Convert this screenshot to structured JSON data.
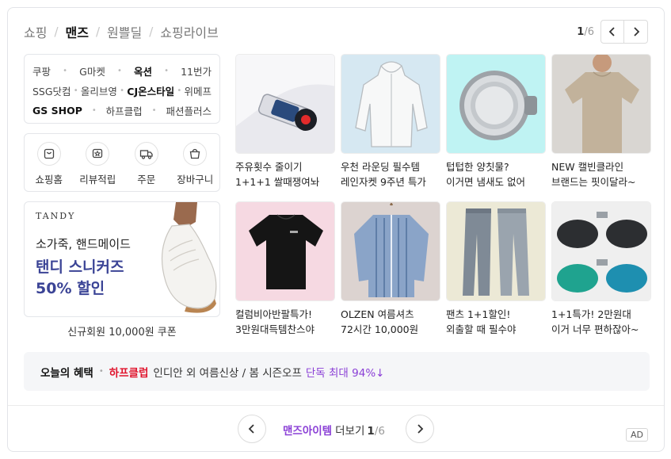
{
  "tabs": [
    {
      "label": "쇼핑"
    },
    {
      "label": "맨즈"
    },
    {
      "label": "원쁠딜"
    },
    {
      "label": "쇼핑라이브"
    }
  ],
  "pager": {
    "current": "1",
    "total": "/6"
  },
  "malls": {
    "row1": [
      "쿠팡",
      "G마켓",
      "옥션",
      "11번가"
    ],
    "row2": [
      "SSG닷컴",
      "올리브영",
      "CJ온스타일",
      "위메프"
    ],
    "row3": [
      "GS SHOP",
      "하프클럽",
      "패션플러스"
    ]
  },
  "quick_menu": [
    {
      "label": "쇼핑홈",
      "icon": "shopping-home-icon"
    },
    {
      "label": "리뷰적립",
      "icon": "review-star-icon"
    },
    {
      "label": "주문",
      "icon": "delivery-truck-icon"
    },
    {
      "label": "장바구니",
      "icon": "shopping-bag-icon"
    }
  ],
  "banner": {
    "brand": "TANDY",
    "line1": "소가죽, 핸드메이드",
    "line2": "탠디 스니커즈",
    "line3": "50% 할인",
    "caption": "신규회원 10,000원 쿠폰"
  },
  "products": [
    {
      "line1": "주유횟수 줄이기",
      "line2": "1+1+1 쌀때쟁여놔",
      "image": "fuel-additive-bottle",
      "bg": "#e9e9ee"
    },
    {
      "line1": "우천 라운딩 필수템",
      "line2": "레인자켓 9주년 특가",
      "image": "white-rain-jacket",
      "bg": "#d6e8f2"
    },
    {
      "line1": "텁텁한 양칫물?",
      "line2": "이거면 냄새도 없어",
      "image": "shower-filter",
      "bg": "#bff3f3"
    },
    {
      "line1": "NEW 캘빈클라인",
      "line2": "브랜드는 핏이달라~",
      "image": "beige-tshirt-model",
      "bg": "#d9d6d2"
    },
    {
      "line1": "컬럼비아반팔특가!",
      "line2": "3만원대득템찬스야",
      "image": "black-tshirt",
      "bg": "#f6d9e2"
    },
    {
      "line1": "OLZEN 여름셔츠",
      "line2": "72시간 10,000원",
      "image": "blue-striped-shirt",
      "bg": "#dcd3d0"
    },
    {
      "line1": "팬츠 1+1할인!",
      "line2": "외출할 때 필수야",
      "image": "gray-pants",
      "bg": "#ece9d6"
    },
    {
      "line1": "1+1특가! 2만원대",
      "line2": "이거 너무 편하잖아~",
      "image": "clip-on-sunglasses",
      "bg": "#efefef"
    }
  ],
  "benefit": {
    "title": "오늘의 혜택",
    "mall": "하프클럽",
    "desc": "인디안 외 여름신상 / 봄 시즌오프",
    "highlight": "단독 최대 94%↓"
  },
  "footer": {
    "more_label": "맨즈아이템",
    "more_suffix": "더보기",
    "page": "1",
    "total": "/6",
    "ad": "AD"
  },
  "colors": {
    "accent_purple": "#8a3fd6",
    "mall_red": "#e0142d",
    "banner_navy": "#3b4496"
  }
}
